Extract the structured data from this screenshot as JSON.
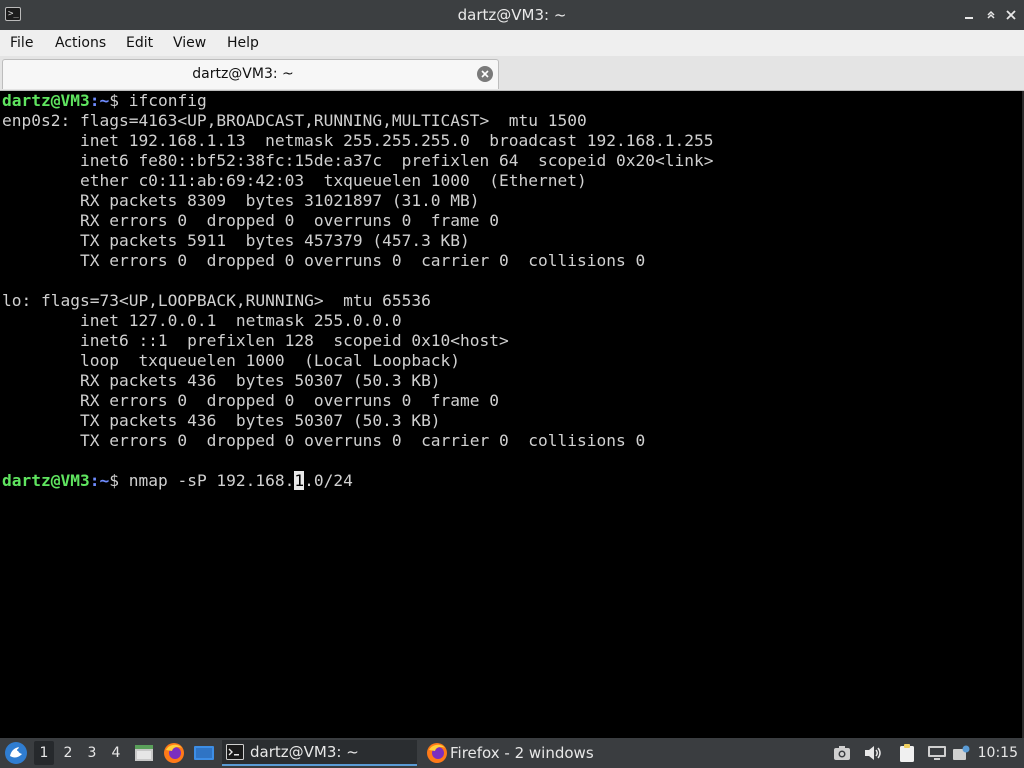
{
  "window": {
    "title": "dartz@VM3: ~",
    "app_icon_glyph": ">_"
  },
  "menu": {
    "file": "File",
    "actions": "Actions",
    "edit": "Edit",
    "view": "View",
    "help": "Help"
  },
  "tab": {
    "label": "dartz@VM3: ~"
  },
  "terminal": {
    "prompt_user_host": "dartz@VM3",
    "prompt_path": ":~",
    "prompt_symbol": "$ ",
    "cmd1": "ifconfig",
    "output": [
      "enp0s2: flags=4163<UP,BROADCAST,RUNNING,MULTICAST>  mtu 1500",
      "        inet 192.168.1.13  netmask 255.255.255.0  broadcast 192.168.1.255",
      "        inet6 fe80::bf52:38fc:15de:a37c  prefixlen 64  scopeid 0x20<link>",
      "        ether c0:11:ab:69:42:03  txqueuelen 1000  (Ethernet)",
      "        RX packets 8309  bytes 31021897 (31.0 MB)",
      "        RX errors 0  dropped 0  overruns 0  frame 0",
      "        TX packets 5911  bytes 457379 (457.3 KB)",
      "        TX errors 0  dropped 0 overruns 0  carrier 0  collisions 0",
      "",
      "lo: flags=73<UP,LOOPBACK,RUNNING>  mtu 65536",
      "        inet 127.0.0.1  netmask 255.0.0.0",
      "        inet6 ::1  prefixlen 128  scopeid 0x10<host>",
      "        loop  txqueuelen 1000  (Local Loopback)",
      "        RX packets 436  bytes 50307 (50.3 KB)",
      "        RX errors 0  dropped 0  overruns 0  frame 0",
      "        TX packets 436  bytes 50307 (50.3 KB)",
      "        TX errors 0  dropped 0 overruns 0  carrier 0  collisions 0",
      ""
    ],
    "cmd2_before_cursor": "nmap -sP 192.168.",
    "cmd2_cursor_char": "1",
    "cmd2_after_cursor": ".0/24"
  },
  "taskbar": {
    "workspaces": [
      "1",
      "2",
      "3",
      "4"
    ],
    "active_workspace": "1",
    "tasks": [
      {
        "label": "dartz@VM3: ~",
        "icon": "terminal-icon",
        "active": true
      },
      {
        "label": "Firefox - 2 windows",
        "icon": "firefox-icon",
        "active": false
      }
    ],
    "clock": "10:15"
  },
  "colors": {
    "prompt_user": "#5fe45f",
    "prompt_path": "#6f8cff",
    "terminal_bg": "#000000",
    "terminal_fg": "#d0d0d0",
    "taskbar_bg": "#3a3d40",
    "titlebar_bg": "#3c3f41"
  }
}
